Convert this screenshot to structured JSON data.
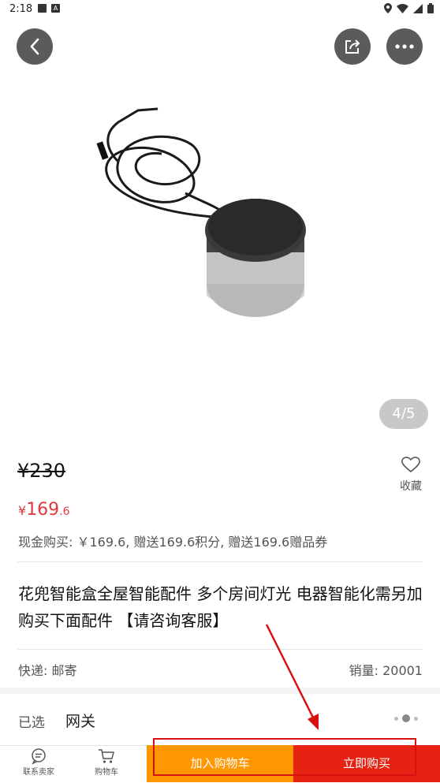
{
  "status_bar": {
    "time": "2:18"
  },
  "gallery": {
    "counter": "4/5"
  },
  "product": {
    "original_price": "¥230",
    "price_symbol": "¥",
    "price_integer": "169",
    "price_decimal": ".6",
    "cash_line": "现金购买: ￥169.6, 赠送169.6积分, 赠送169.6赠品券",
    "title": "花兜智能盒全屋智能配件   多个房间灯光 电器智能化需另加购买下面配件 【请咨询客服】",
    "delivery": "快递: 邮寄",
    "sales": "销量: 20001"
  },
  "favorite": {
    "label": "收藏"
  },
  "selection": {
    "label": "已选",
    "value": "网关"
  },
  "bottom_bar": {
    "contact_label": "联系卖家",
    "cart_label": "购物车",
    "add_to_cart": "加入购物车",
    "buy_now": "立即购买"
  },
  "colors": {
    "price_red": "#e4393c",
    "cart_orange": "#ff9800",
    "buy_red": "#e62212",
    "annotation_red": "#d81010"
  },
  "icons": [
    "back-icon",
    "share-icon",
    "more-icon",
    "heart-icon",
    "chat-icon",
    "cart-icon"
  ]
}
